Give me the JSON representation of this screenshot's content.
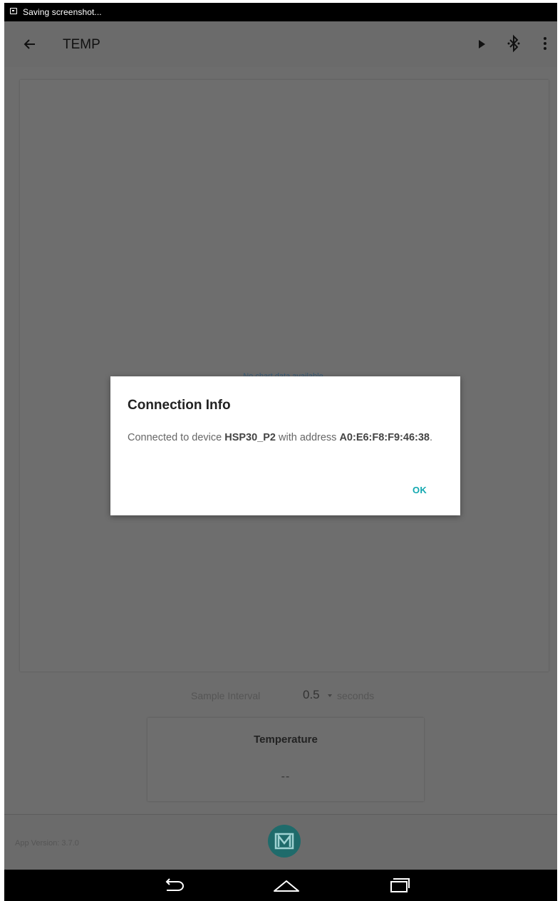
{
  "status_bar": {
    "text": "Saving screenshot..."
  },
  "app_bar": {
    "title": "TEMP"
  },
  "chart": {
    "empty_text": "No chart data available."
  },
  "sample_interval": {
    "label": "Sample Interval",
    "value": "0.5",
    "unit": "seconds"
  },
  "temperature": {
    "label": "Temperature",
    "value": "--"
  },
  "footer": {
    "app_version": "App Version: 3.7.0"
  },
  "dialog": {
    "title": "Connection Info",
    "message_prefix": "Connected to device ",
    "device_name": "HSP30_P2",
    "message_middle": " with address ",
    "address": "A0:E6:F8:F9:46:38",
    "message_suffix": ".",
    "ok_label": "OK"
  },
  "colors": {
    "accent": "#12a8b0",
    "scrim": "#6d6d6d",
    "logo": "#1f6b6b"
  }
}
